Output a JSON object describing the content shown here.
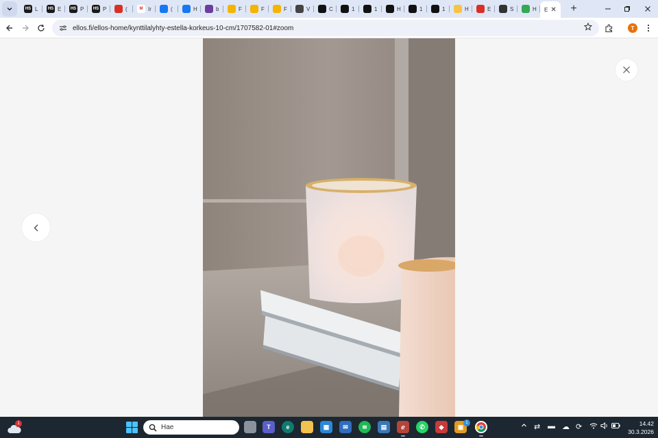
{
  "browser": {
    "tabs": [
      {
        "icon": "hs-logo-icon",
        "letter": "L",
        "color": "#1a1a1a"
      },
      {
        "icon": "hs-logo-icon",
        "letter": "E",
        "color": "#1a1a1a"
      },
      {
        "icon": "hs-logo-icon",
        "letter": "P",
        "color": "#1a1a1a"
      },
      {
        "icon": "hs-logo-icon",
        "letter": "P",
        "color": "#1a1a1a"
      },
      {
        "icon": "vpn-icon",
        "letter": "(",
        "color": "#d93025"
      },
      {
        "icon": "gmail-icon",
        "letter": "Ir",
        "color": "#ffffff"
      },
      {
        "icon": "facebook-icon",
        "letter": "(",
        "color": "#1877f2"
      },
      {
        "icon": "facebook-icon",
        "letter": "H",
        "color": "#1877f2"
      },
      {
        "icon": "bookmark-b-icon",
        "letter": "b",
        "color": "#6a3fa0"
      },
      {
        "icon": "flag-icon",
        "letter": "F",
        "color": "#f4b400"
      },
      {
        "icon": "flag-icon",
        "letter": "F",
        "color": "#f4b400"
      },
      {
        "icon": "flag-icon",
        "letter": "F",
        "color": "#f4b400"
      },
      {
        "icon": "globe-icon",
        "letter": "V",
        "color": "#444444"
      },
      {
        "icon": "play-box-icon",
        "letter": "C",
        "color": "#111111"
      },
      {
        "icon": "play-box-icon",
        "letter": "1",
        "color": "#111111"
      },
      {
        "icon": "play-box-icon",
        "letter": "1",
        "color": "#111111"
      },
      {
        "icon": "play-box-icon",
        "letter": "H",
        "color": "#111111"
      },
      {
        "icon": "play-box-icon",
        "letter": "1",
        "color": "#111111"
      },
      {
        "icon": "play-box-icon",
        "letter": "1",
        "color": "#111111"
      },
      {
        "icon": "smiley-icon",
        "letter": "H",
        "color": "#f6c342"
      },
      {
        "icon": "red-envelope-icon",
        "letter": "E",
        "color": "#d93025"
      },
      {
        "icon": "eye-icon",
        "letter": "S",
        "color": "#333333"
      },
      {
        "icon": "maps-pin-icon",
        "letter": "H",
        "color": "#34a853"
      }
    ],
    "active_tab": {
      "letter": "E"
    },
    "new_tab": "+",
    "url": "ellos.fi/ellos-home/kynttilalyhty-estella-korkeus-10-cm/1707582-01#zoom",
    "profile_initial": "T",
    "accent": "#e8710a"
  },
  "viewer": {
    "close_icon": "close-icon",
    "prev_icon": "chevron-left-icon",
    "image_icon": "candle-holder-photo"
  },
  "taskbar": {
    "weather_badge": "1",
    "search_placeholder": "Hae",
    "app_badge": "1",
    "time": "14.42",
    "date": "30.3.2026"
  }
}
